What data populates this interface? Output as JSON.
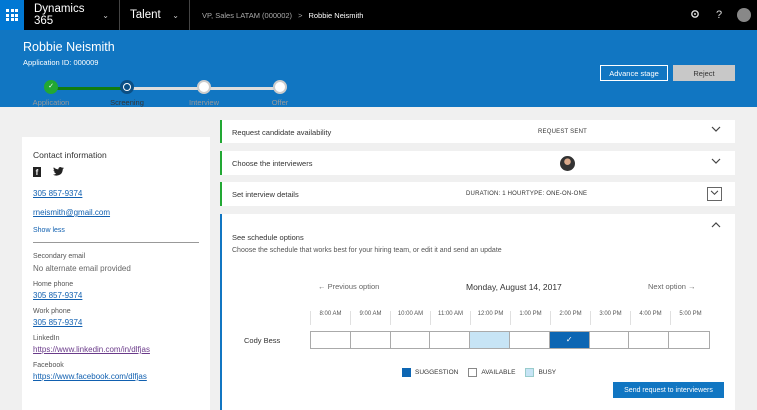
{
  "nav": {
    "brand": "Dynamics 365",
    "app": "Talent",
    "breadcrumb_parent": "VP, Sales LATAM (000002)",
    "breadcrumb_separator": ">",
    "breadcrumb_current": "Robbie Neismith",
    "settings_icon": "gear-icon",
    "help_icon": "?",
    "chevron": "⌄"
  },
  "header": {
    "name": "Robbie Neismith",
    "application_id": "Application ID: 000009",
    "advance_label": "Advance stage",
    "reject_label": "Reject"
  },
  "stages": [
    {
      "label": "Application",
      "state": "done"
    },
    {
      "label": "Screening",
      "state": "current"
    },
    {
      "label": "Interview",
      "state": "todo"
    },
    {
      "label": "Offer",
      "state": "todo"
    }
  ],
  "contact": {
    "title": "Contact information",
    "phone": "305 857-9374",
    "email": "rneismith@gmail.com",
    "show_less": "Show less",
    "secondary_email_label": "Secondary email",
    "secondary_email_value": "No alternate email provided",
    "home_phone_label": "Home phone",
    "home_phone": "305 857-9374",
    "work_phone_label": "Work phone",
    "work_phone": "305 857-9374",
    "linkedin_label": "LinkedIn",
    "linkedin": "https://www.linkedin.com/in/dlfjas",
    "facebook_label": "Facebook",
    "facebook": "https://www.facebook.com/dlfjas"
  },
  "panels": {
    "availability_title": "Request candidate availability",
    "availability_status": "REQUEST SENT",
    "interviewers_title": "Choose the interviewers",
    "details_title": "Set interview details",
    "details_duration": "DURATION: 1 HOUR",
    "details_type": "TYPE: ONE-ON-ONE",
    "schedule_title": "See schedule options",
    "schedule_subtitle": "Choose the schedule that works best for your hiring team, or edit it and send an update",
    "prev_label": "←   Previous option",
    "date": "Monday, August 14, 2017",
    "next_label": "Next option   →",
    "times": [
      "8:00 AM",
      "9:00 AM",
      "10:00 AM",
      "11:00 AM",
      "12:00 PM",
      "1:00 PM",
      "2:00 PM",
      "3:00 PM",
      "4:00 PM",
      "5:00 PM"
    ],
    "person": "Cody Bess",
    "slots": [
      "available",
      "available",
      "available",
      "available",
      "busy",
      "available",
      "suggestion",
      "available",
      "available",
      "available"
    ],
    "check_mark": "✓",
    "legend_suggestion": "SUGGESTION",
    "legend_available": "AVAILABLE",
    "legend_busy": "BUSY",
    "send_label": "Send request to interviewers"
  },
  "colors": {
    "accent": "#1176c2",
    "suggestion": "#0d66b3",
    "busy": "#c7e4f5",
    "done": "#22a834"
  }
}
